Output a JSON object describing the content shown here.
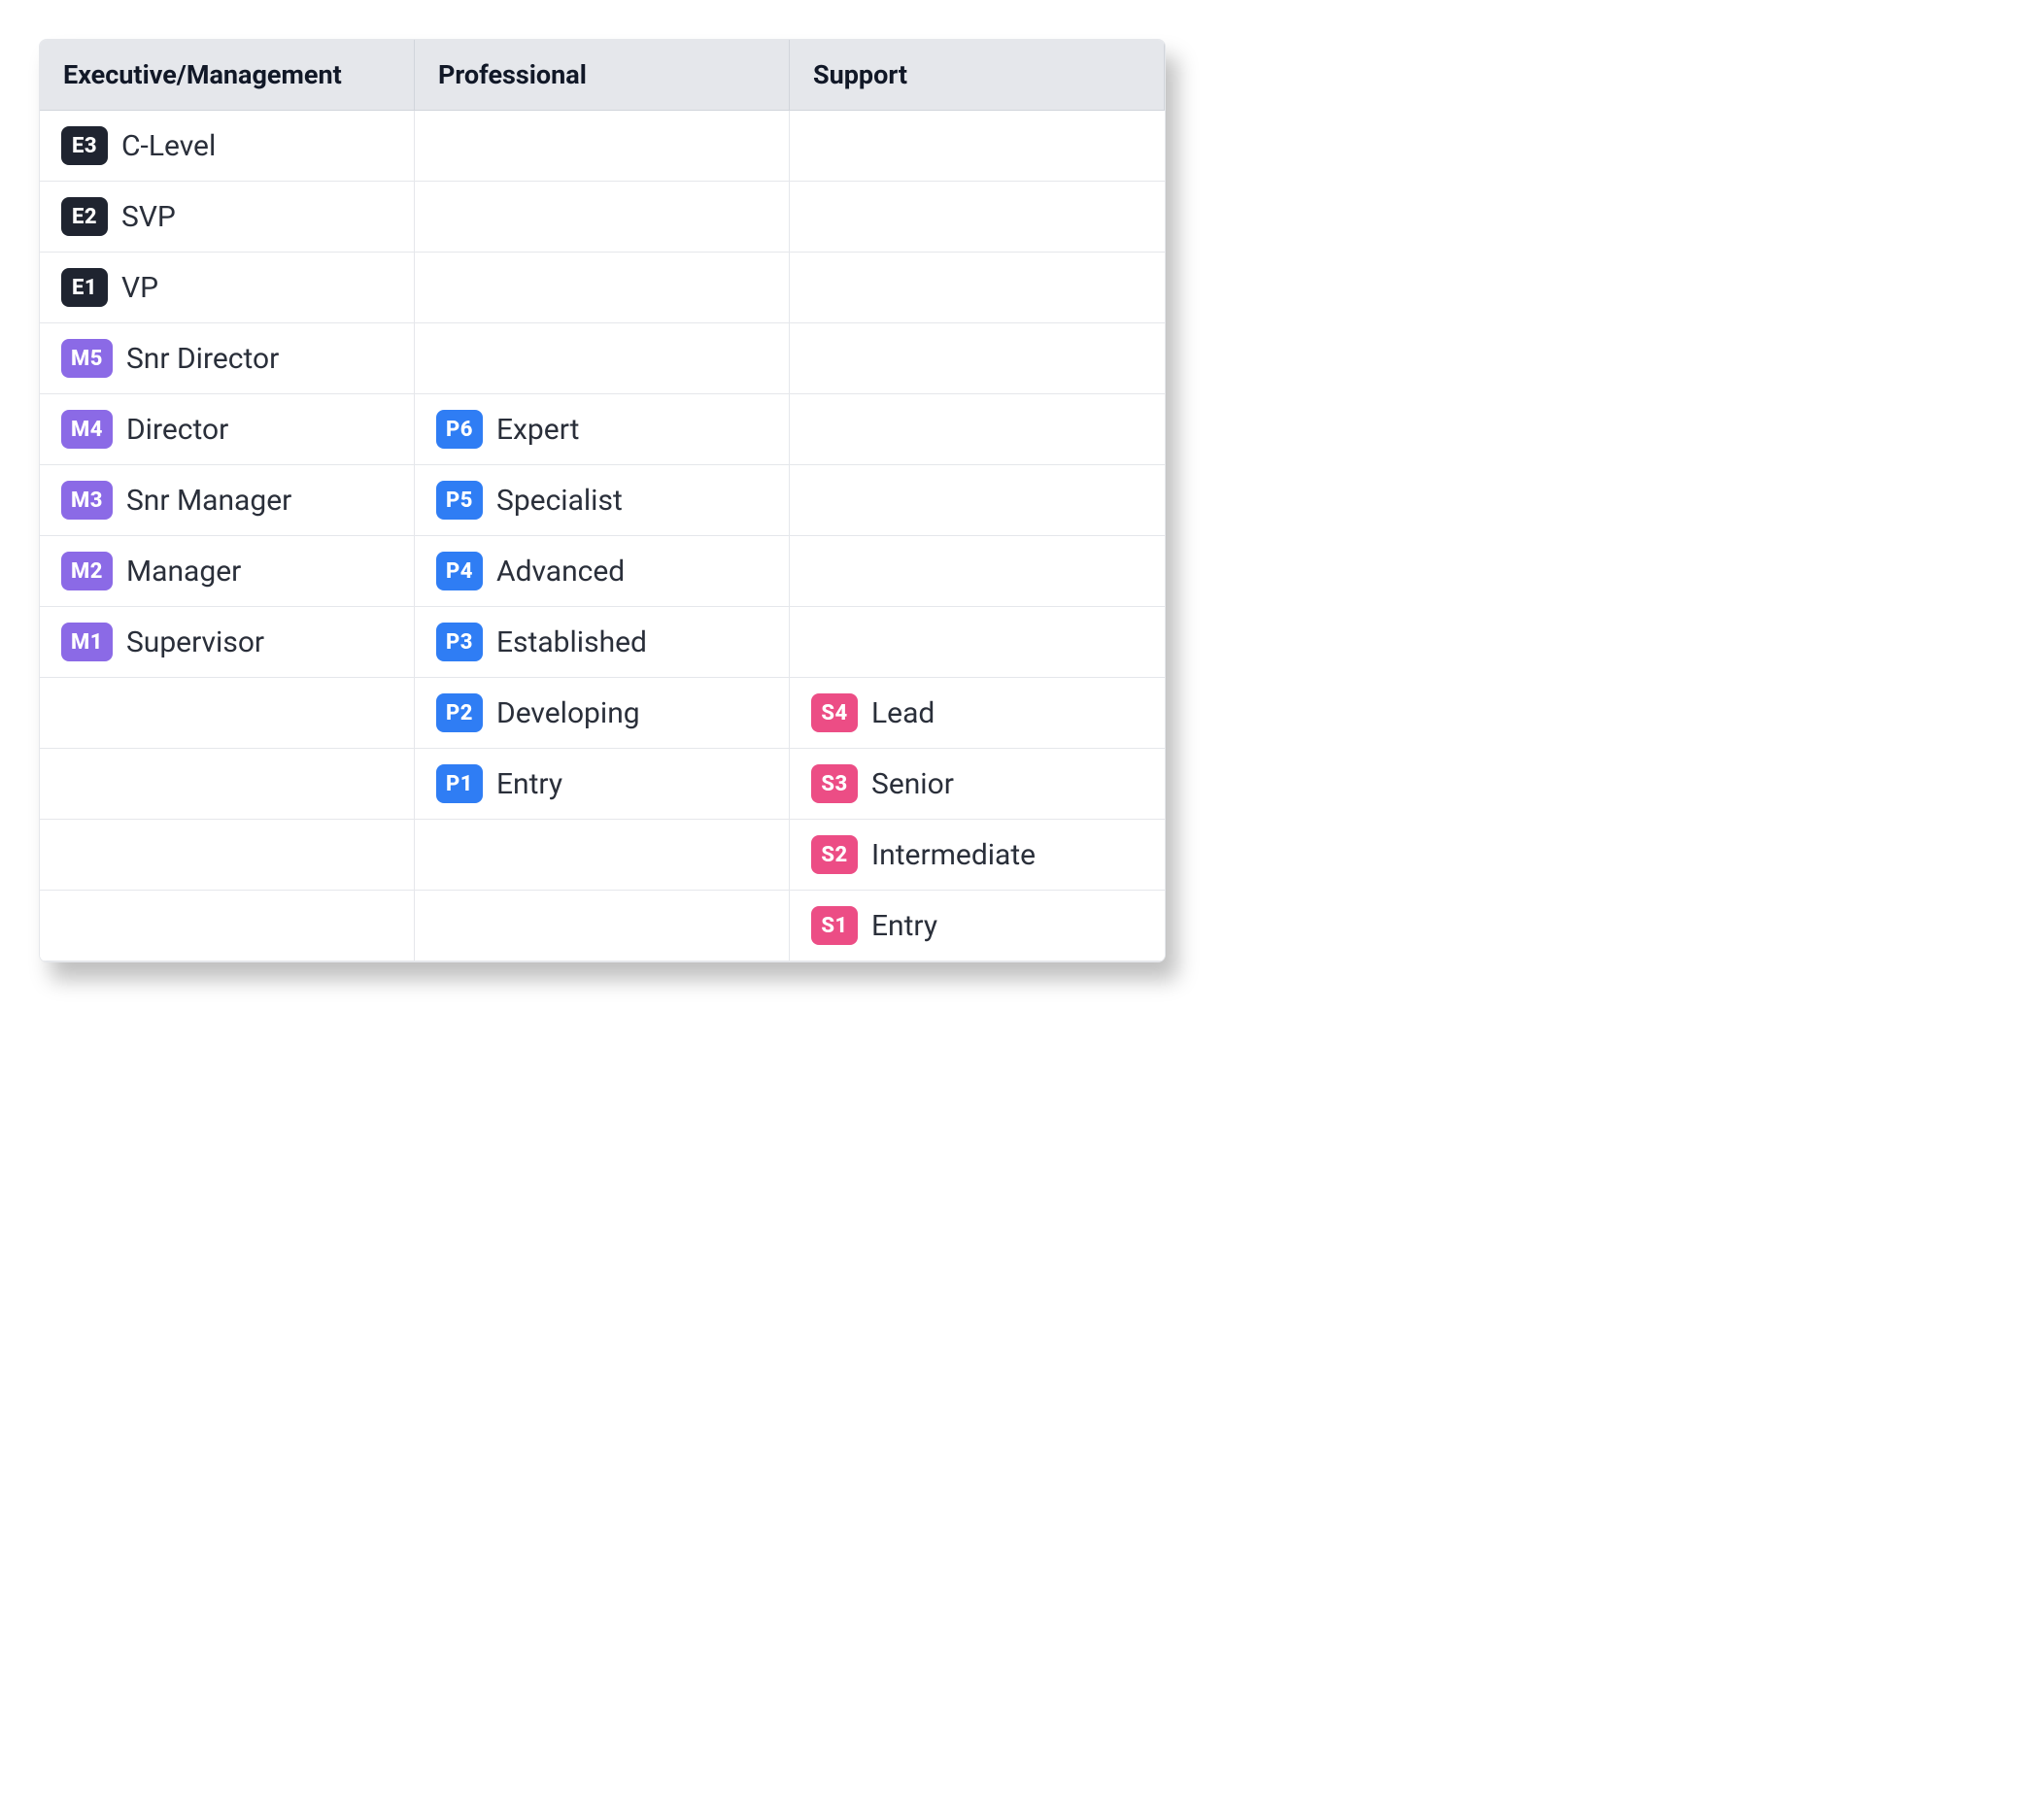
{
  "headers": [
    "Executive/Management",
    "Professional",
    "Support"
  ],
  "badge_classes": {
    "E": "badge-e",
    "M": "badge-m",
    "P": "badge-p",
    "S": "badge-s"
  },
  "rows": [
    [
      {
        "code": "E3",
        "prefix": "E",
        "label": "C-Level"
      },
      null,
      null
    ],
    [
      {
        "code": "E2",
        "prefix": "E",
        "label": "SVP"
      },
      null,
      null
    ],
    [
      {
        "code": "E1",
        "prefix": "E",
        "label": "VP"
      },
      null,
      null
    ],
    [
      {
        "code": "M5",
        "prefix": "M",
        "label": "Snr Director"
      },
      null,
      null
    ],
    [
      {
        "code": "M4",
        "prefix": "M",
        "label": "Director"
      },
      {
        "code": "P6",
        "prefix": "P",
        "label": "Expert"
      },
      null
    ],
    [
      {
        "code": "M3",
        "prefix": "M",
        "label": "Snr Manager"
      },
      {
        "code": "P5",
        "prefix": "P",
        "label": "Specialist"
      },
      null
    ],
    [
      {
        "code": "M2",
        "prefix": "M",
        "label": "Manager"
      },
      {
        "code": "P4",
        "prefix": "P",
        "label": "Advanced"
      },
      null
    ],
    [
      {
        "code": "M1",
        "prefix": "M",
        "label": "Supervisor"
      },
      {
        "code": "P3",
        "prefix": "P",
        "label": "Established"
      },
      null
    ],
    [
      null,
      {
        "code": "P2",
        "prefix": "P",
        "label": "Developing"
      },
      {
        "code": "S4",
        "prefix": "S",
        "label": "Lead"
      }
    ],
    [
      null,
      {
        "code": "P1",
        "prefix": "P",
        "label": "Entry"
      },
      {
        "code": "S3",
        "prefix": "S",
        "label": "Senior"
      }
    ],
    [
      null,
      null,
      {
        "code": "S2",
        "prefix": "S",
        "label": "Intermediate"
      }
    ],
    [
      null,
      null,
      {
        "code": "S1",
        "prefix": "S",
        "label": "Entry"
      }
    ]
  ]
}
